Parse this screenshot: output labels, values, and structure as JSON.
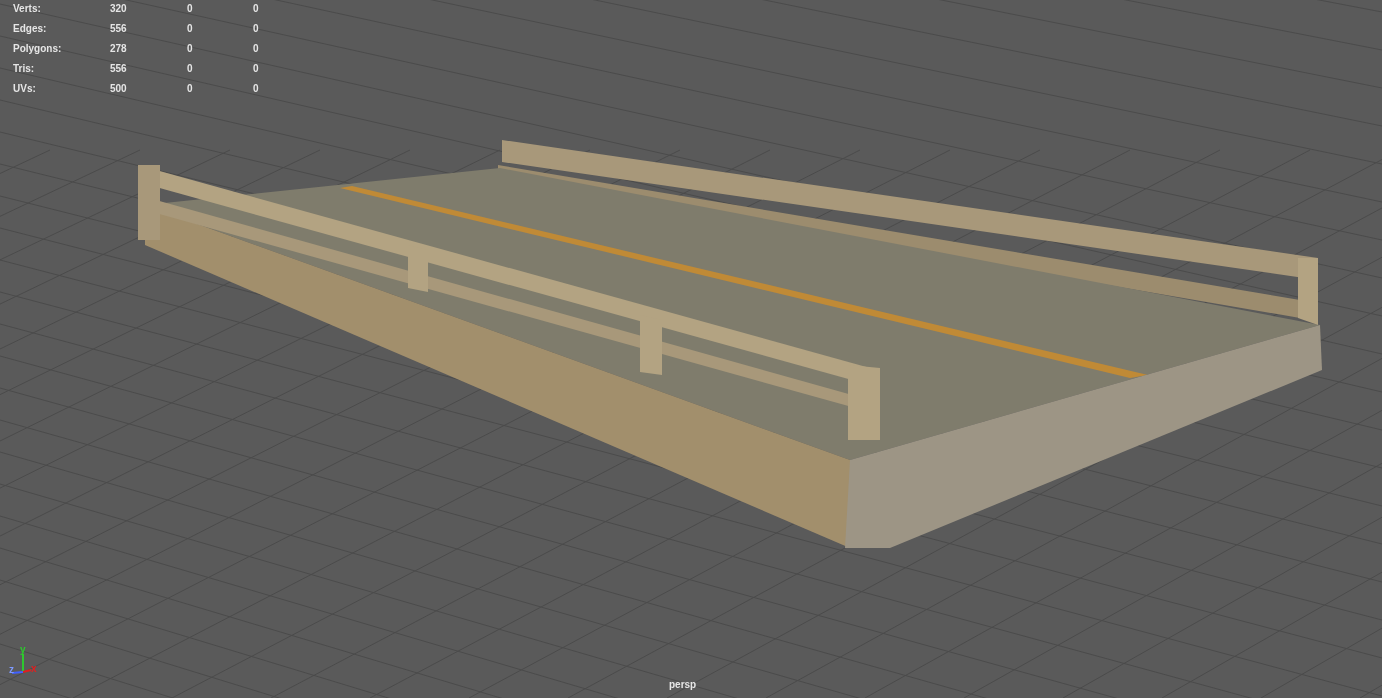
{
  "stats": [
    {
      "label": "Verts:",
      "values": [
        "320",
        "0",
        "0"
      ]
    },
    {
      "label": "Edges:",
      "values": [
        "556",
        "0",
        "0"
      ]
    },
    {
      "label": "Polygons:",
      "values": [
        "278",
        "0",
        "0"
      ]
    },
    {
      "label": "Tris:",
      "values": [
        "556",
        "0",
        "0"
      ]
    },
    {
      "label": "UVs:",
      "values": [
        "500",
        "0",
        "0"
      ]
    }
  ],
  "axis_labels": {
    "x": "x",
    "y": "y",
    "z": "z"
  },
  "camera": "persp"
}
